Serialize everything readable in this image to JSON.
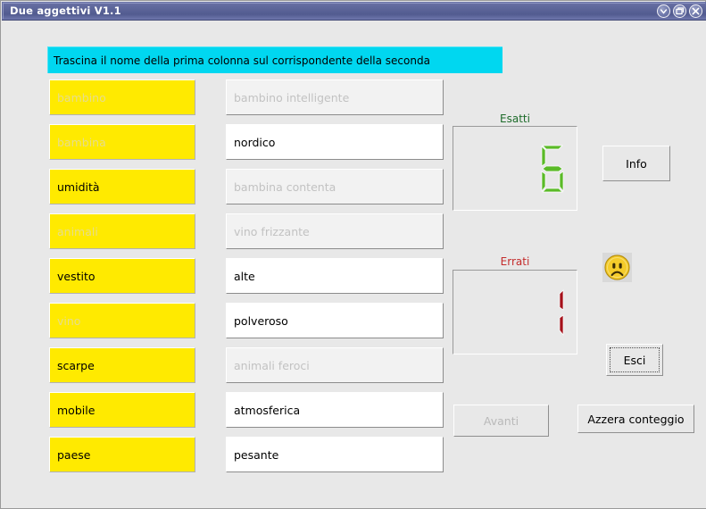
{
  "window": {
    "title": "Due aggettivi V1.1",
    "buttons": [
      {
        "name": "minimize-button",
        "icon": "chevron-down-icon"
      },
      {
        "name": "maximize-button",
        "icon": "restore-window-icon"
      },
      {
        "name": "close-button",
        "icon": "close-icon"
      }
    ]
  },
  "banner": {
    "text": "Trascina il nome della prima colonna sul corrispondente della seconda"
  },
  "nouns": [
    {
      "label": "bambino",
      "done": true
    },
    {
      "label": "bambina",
      "done": true
    },
    {
      "label": "umidità",
      "done": false
    },
    {
      "label": "animali",
      "done": true
    },
    {
      "label": "vestito",
      "done": false
    },
    {
      "label": "vino",
      "done": true
    },
    {
      "label": "scarpe",
      "done": false
    },
    {
      "label": "mobile",
      "done": false
    },
    {
      "label": "paese",
      "done": false
    }
  ],
  "phrases": [
    {
      "label": "bambino intelligente",
      "done": true
    },
    {
      "label": "nordico",
      "done": false
    },
    {
      "label": "bambina contenta",
      "done": true
    },
    {
      "label": "vino frizzante",
      "done": true
    },
    {
      "label": "alte",
      "done": false
    },
    {
      "label": "polveroso",
      "done": false
    },
    {
      "label": "animali feroci",
      "done": true
    },
    {
      "label": "atmosferica",
      "done": false
    },
    {
      "label": "pesante",
      "done": false
    }
  ],
  "scores": {
    "correct": {
      "label": "Esatti",
      "value": "6",
      "color": "#1d6b2a",
      "segment_on": "#5aba27"
    },
    "wrong": {
      "label": "Errati",
      "value": "1",
      "color": "#c42b2b",
      "segment_on": "#a5101a"
    }
  },
  "feedback_icon": "sad-face-icon",
  "buttons": {
    "info": {
      "label": "Info",
      "disabled": false,
      "focused": false
    },
    "esci": {
      "label": "Esci",
      "disabled": false,
      "focused": true
    },
    "avanti": {
      "label": "Avanti",
      "disabled": true,
      "focused": false
    },
    "azzera": {
      "label": "Azzera conteggio",
      "disabled": false,
      "focused": false
    }
  }
}
